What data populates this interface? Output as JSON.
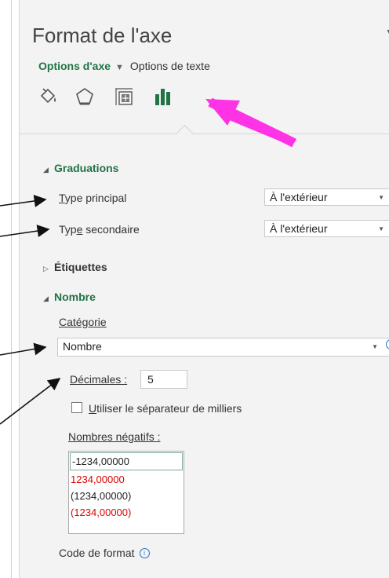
{
  "pane": {
    "title": "Format de l'axe",
    "tab_axis": "Options d'axe",
    "tab_text": "Options de texte"
  },
  "icons": [
    "fill-bucket-icon",
    "pentagon-icon",
    "size-properties-icon",
    "bar-chart-icon"
  ],
  "graduations": {
    "header": "Graduations",
    "main_label_pre": "",
    "main_label_u": "T",
    "main_label_post": "ype principal",
    "main_value": "À l'extérieur",
    "minor_label_pre": "Typ",
    "minor_label_u": "e",
    "minor_label_post": " secondaire",
    "minor_value": "À l'extérieur"
  },
  "etiquettes": {
    "header": "Étiquettes"
  },
  "nombre": {
    "header": "Nombre",
    "category_label": "Catégorie",
    "category_value": "Nombre",
    "decimals_label": "Décimales :",
    "decimals_value": "5",
    "separator_label_u": "U",
    "separator_label_post": "tiliser le séparateur de milliers",
    "separator_checked": false,
    "negative_label": "Nombres négatifs :",
    "negative_options": [
      "-1234,00000",
      "1234,00000",
      "(1234,00000)",
      "(1234,00000)"
    ],
    "format_code_label": "Code de format"
  },
  "colors": {
    "accent_green": "#217346",
    "negative_red": "#e00000",
    "annotation_arrow_magenta": "#ff00ff"
  }
}
